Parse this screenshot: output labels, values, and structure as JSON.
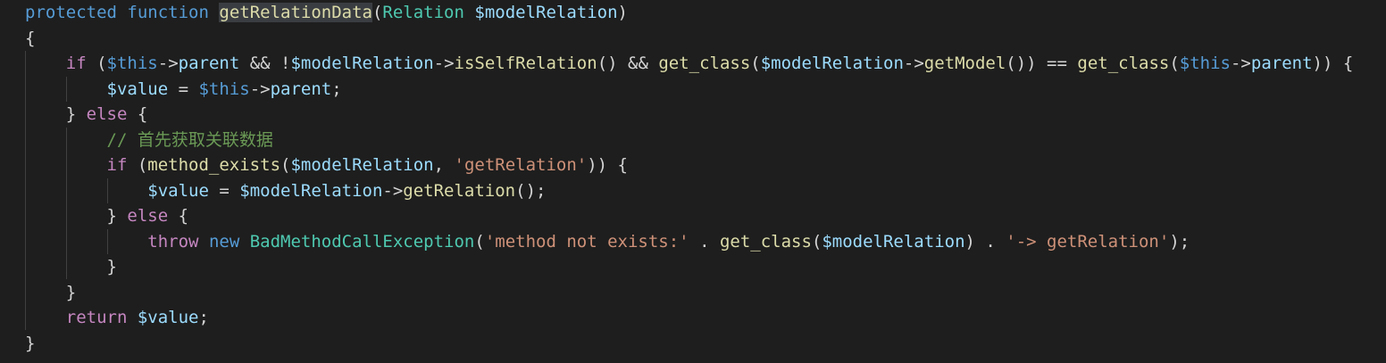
{
  "editor": {
    "lines": [
      [
        {
          "t": "protected",
          "c": "kw"
        },
        {
          "t": " ",
          "c": "pun"
        },
        {
          "t": "function",
          "c": "kw"
        },
        {
          "t": " ",
          "c": "pun"
        },
        {
          "t": "getRelationData",
          "c": "fn hl"
        },
        {
          "t": "(",
          "c": "pun"
        },
        {
          "t": "Relation",
          "c": "ty"
        },
        {
          "t": " ",
          "c": "pun"
        },
        {
          "t": "$modelRelation",
          "c": "var"
        },
        {
          "t": ")",
          "c": "pun"
        }
      ],
      [
        {
          "t": "{",
          "c": "pun"
        }
      ],
      [
        {
          "t": "    ",
          "c": "pun"
        },
        {
          "t": "if",
          "c": "ctl"
        },
        {
          "t": " (",
          "c": "pun"
        },
        {
          "t": "$this",
          "c": "kw"
        },
        {
          "t": "->",
          "c": "pun"
        },
        {
          "t": "parent",
          "c": "var"
        },
        {
          "t": " && !",
          "c": "pun"
        },
        {
          "t": "$modelRelation",
          "c": "var"
        },
        {
          "t": "->",
          "c": "pun"
        },
        {
          "t": "isSelfRelation",
          "c": "fn"
        },
        {
          "t": "() && ",
          "c": "pun"
        },
        {
          "t": "get_class",
          "c": "fn"
        },
        {
          "t": "(",
          "c": "pun"
        },
        {
          "t": "$modelRelation",
          "c": "var"
        },
        {
          "t": "->",
          "c": "pun"
        },
        {
          "t": "getModel",
          "c": "fn"
        },
        {
          "t": "()) == ",
          "c": "pun"
        },
        {
          "t": "get_class",
          "c": "fn"
        },
        {
          "t": "(",
          "c": "pun"
        },
        {
          "t": "$this",
          "c": "kw"
        },
        {
          "t": "->",
          "c": "pun"
        },
        {
          "t": "parent",
          "c": "var"
        },
        {
          "t": ")) {",
          "c": "pun"
        }
      ],
      [
        {
          "t": "        ",
          "c": "pun"
        },
        {
          "t": "$value",
          "c": "var"
        },
        {
          "t": " = ",
          "c": "pun"
        },
        {
          "t": "$this",
          "c": "kw"
        },
        {
          "t": "->",
          "c": "pun"
        },
        {
          "t": "parent",
          "c": "var"
        },
        {
          "t": ";",
          "c": "pun"
        }
      ],
      [
        {
          "t": "    } ",
          "c": "pun"
        },
        {
          "t": "else",
          "c": "ctl"
        },
        {
          "t": " {",
          "c": "pun"
        }
      ],
      [
        {
          "t": "        ",
          "c": "pun"
        },
        {
          "t": "// 首先获取关联数据",
          "c": "cmt"
        }
      ],
      [
        {
          "t": "        ",
          "c": "pun"
        },
        {
          "t": "if",
          "c": "ctl"
        },
        {
          "t": " (",
          "c": "pun"
        },
        {
          "t": "method_exists",
          "c": "fn"
        },
        {
          "t": "(",
          "c": "pun"
        },
        {
          "t": "$modelRelation",
          "c": "var"
        },
        {
          "t": ", ",
          "c": "pun"
        },
        {
          "t": "'getRelation'",
          "c": "str"
        },
        {
          "t": ")) {",
          "c": "pun"
        }
      ],
      [
        {
          "t": "            ",
          "c": "pun"
        },
        {
          "t": "$value",
          "c": "var"
        },
        {
          "t": " = ",
          "c": "pun"
        },
        {
          "t": "$modelRelation",
          "c": "var"
        },
        {
          "t": "->",
          "c": "pun"
        },
        {
          "t": "getRelation",
          "c": "fn"
        },
        {
          "t": "();",
          "c": "pun"
        }
      ],
      [
        {
          "t": "        } ",
          "c": "pun"
        },
        {
          "t": "else",
          "c": "ctl"
        },
        {
          "t": " {",
          "c": "pun"
        }
      ],
      [
        {
          "t": "            ",
          "c": "pun"
        },
        {
          "t": "throw",
          "c": "ctl"
        },
        {
          "t": " ",
          "c": "pun"
        },
        {
          "t": "new",
          "c": "kw"
        },
        {
          "t": " ",
          "c": "pun"
        },
        {
          "t": "BadMethodCallException",
          "c": "ty"
        },
        {
          "t": "(",
          "c": "pun"
        },
        {
          "t": "'method not exists:'",
          "c": "str"
        },
        {
          "t": " . ",
          "c": "pun"
        },
        {
          "t": "get_class",
          "c": "fn"
        },
        {
          "t": "(",
          "c": "pun"
        },
        {
          "t": "$modelRelation",
          "c": "var"
        },
        {
          "t": ") . ",
          "c": "pun"
        },
        {
          "t": "'-> getRelation'",
          "c": "str"
        },
        {
          "t": ");",
          "c": "pun"
        }
      ],
      [
        {
          "t": "        }",
          "c": "pun"
        }
      ],
      [
        {
          "t": "    }",
          "c": "pun"
        }
      ],
      [
        {
          "t": "    ",
          "c": "pun"
        },
        {
          "t": "return",
          "c": "ctl"
        },
        {
          "t": " ",
          "c": "pun"
        },
        {
          "t": "$value",
          "c": "var"
        },
        {
          "t": ";",
          "c": "pun"
        }
      ],
      [
        {
          "t": "}",
          "c": "pun"
        }
      ]
    ]
  }
}
